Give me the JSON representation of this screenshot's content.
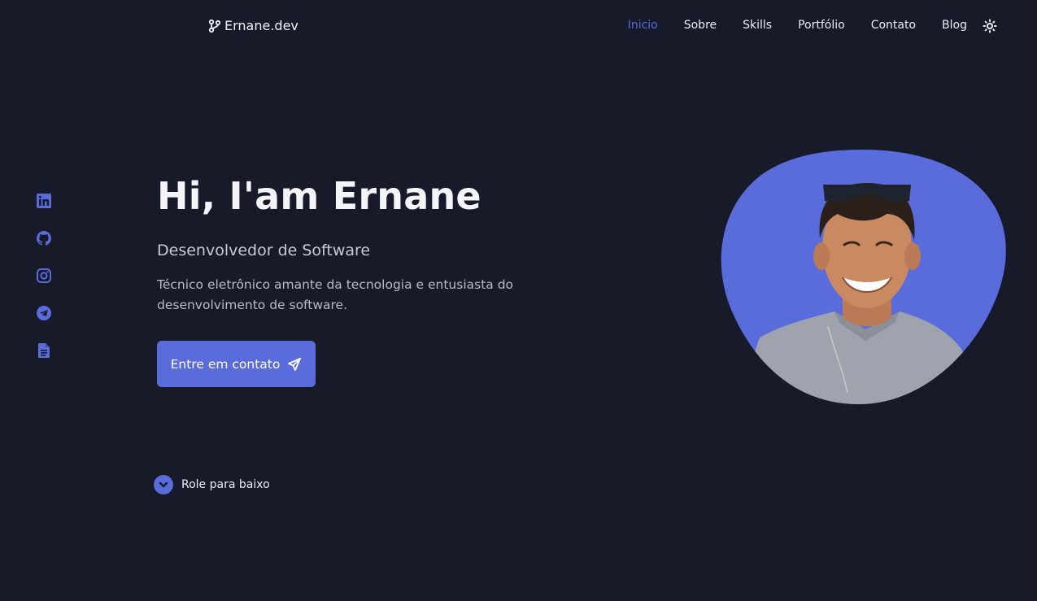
{
  "header": {
    "logo_text": "Ernane.dev",
    "nav": [
      {
        "label": "Inicio",
        "active": true
      },
      {
        "label": "Sobre"
      },
      {
        "label": "Skills"
      },
      {
        "label": "Portfólio"
      },
      {
        "label": "Contato"
      },
      {
        "label": "Blog"
      }
    ],
    "theme_icon": "sun-icon"
  },
  "social": [
    {
      "icon": "linkedin-icon"
    },
    {
      "icon": "github-icon"
    },
    {
      "icon": "instagram-icon"
    },
    {
      "icon": "telegram-icon"
    },
    {
      "icon": "document-icon"
    }
  ],
  "hero": {
    "title": "Hi, I'am Ernane",
    "subtitle": "Desenvolvedor de Software",
    "description": "Técnico eletrônico amante da tecnologia e entusiasta do desenvolvimento de software.",
    "cta_label": "Entre em contato",
    "scroll_label": "Role para baixo"
  },
  "colors": {
    "background": "#171a29",
    "accent": "#5a6bdc"
  }
}
